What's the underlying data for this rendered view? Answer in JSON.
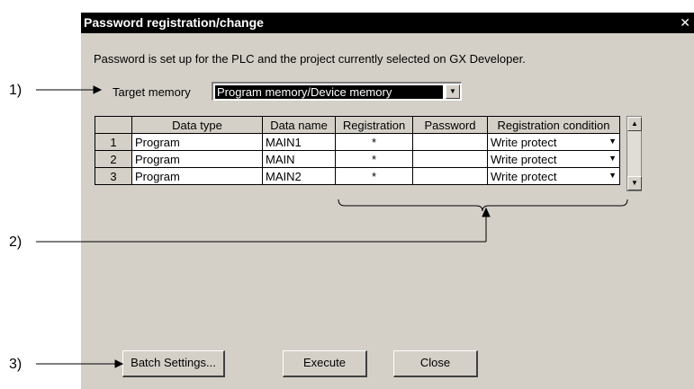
{
  "callouts": [
    "1)",
    "2)",
    "3)"
  ],
  "dialog": {
    "title": "Password registration/change",
    "close_glyph": "✕",
    "description": "Password is set up for the PLC and the project currently selected on GX Developer.",
    "target_memory_label": "Target memory",
    "target_memory_value": "Program memory/Device memory",
    "columns": [
      "",
      "Data type",
      "Data name",
      "Registration",
      "Password",
      "Registration condition"
    ],
    "rows": [
      {
        "no": "1",
        "type": "Program",
        "name": "MAIN1",
        "registration": "*",
        "password": "",
        "condition": "Write protect"
      },
      {
        "no": "2",
        "type": "Program",
        "name": "MAIN",
        "registration": "*",
        "password": "",
        "condition": "Write protect"
      },
      {
        "no": "3",
        "type": "Program",
        "name": "MAIN2",
        "registration": "*",
        "password": "",
        "condition": "Write protect"
      }
    ],
    "buttons": {
      "batch": "Batch Settings...",
      "execute": "Execute",
      "close": "Close"
    }
  }
}
